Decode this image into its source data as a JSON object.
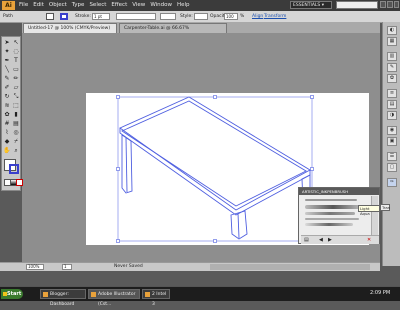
{
  "menubar": {
    "logo": "Ai",
    "items": [
      "File",
      "Edit",
      "Object",
      "Type",
      "Select",
      "Effect",
      "View",
      "Window",
      "Help"
    ],
    "workspace": "ESSENTIALS",
    "workspace_caret": "▾"
  },
  "control": {
    "selection_label": "Path",
    "stroke_label": "Stroke:",
    "stroke_weight": "1 pt",
    "style_label": "Style:",
    "opacity_label": "Opacity:",
    "opacity_value": "100",
    "opacity_unit": "%",
    "links": [
      "Align",
      "Transform"
    ]
  },
  "tabs": [
    {
      "label": "Untitled-17 @ 100% (CMYK/Preview)"
    },
    {
      "label": "Carpenter-Table.ai @ 66.67% (RGB/Preview)"
    }
  ],
  "tools": [
    "selection",
    "direct-selection",
    "magic-wand",
    "lasso",
    "pen",
    "type",
    "line",
    "rectangle",
    "paintbrush",
    "pencil",
    "blob-brush",
    "eraser",
    "rotate",
    "scale",
    "warp",
    "free-transform",
    "symbol-sprayer",
    "graph",
    "mesh",
    "gradient",
    "eyedropper",
    "blend",
    "live-paint",
    "slice",
    "hand",
    "zoom"
  ],
  "panel": {
    "title": "ARTISTIC_INKPENBRUSH",
    "tooltip": "Light Aqua",
    "tooltip2": "Tran"
  },
  "status": {
    "zoom": "100%",
    "page": "1",
    "saved": "Never Saved"
  },
  "taskbar": {
    "start": "Start",
    "tasks": [
      {
        "label": "Blogger: Dashboard"
      },
      {
        "label": "Adobe Illustrator (Cst..."
      },
      {
        "label": "2 Intel 3"
      }
    ],
    "clock": "2:09 PM"
  },
  "colors": {
    "selection": "#4f5fe0",
    "artboard": "#ffffff",
    "canvas": "#8e8e8e"
  }
}
